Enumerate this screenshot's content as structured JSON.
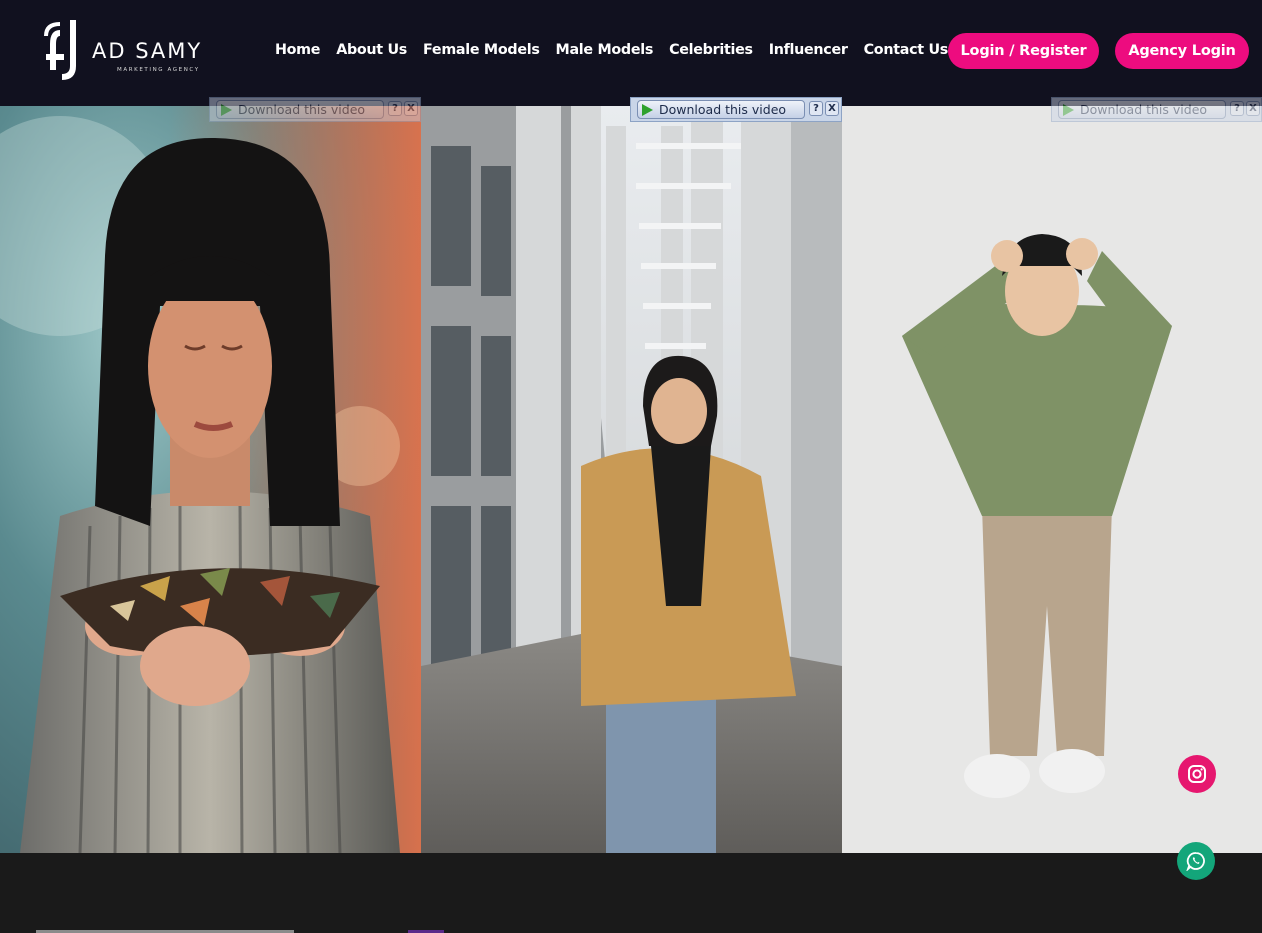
{
  "brand": {
    "name": "AD SAMY",
    "tagline": "MARKETING AGENCY"
  },
  "nav": {
    "items": [
      "Home",
      "About Us",
      "Female Models",
      "Male Models",
      "Celebrities",
      "Influencer",
      "Contact Us"
    ]
  },
  "buttons": {
    "login": "Login / Register",
    "agency": "Agency Login"
  },
  "video_toolbar": {
    "download_label": "Download this video",
    "help_label": "?",
    "close_label": "X"
  },
  "floating": {
    "instagram_icon": "instagram-icon",
    "whatsapp_icon": "whatsapp-icon"
  },
  "colors": {
    "header_bg": "#11111f",
    "accent": "#ed0c7f",
    "instagram": "#e6176f",
    "whatsapp": "#13a67a"
  }
}
